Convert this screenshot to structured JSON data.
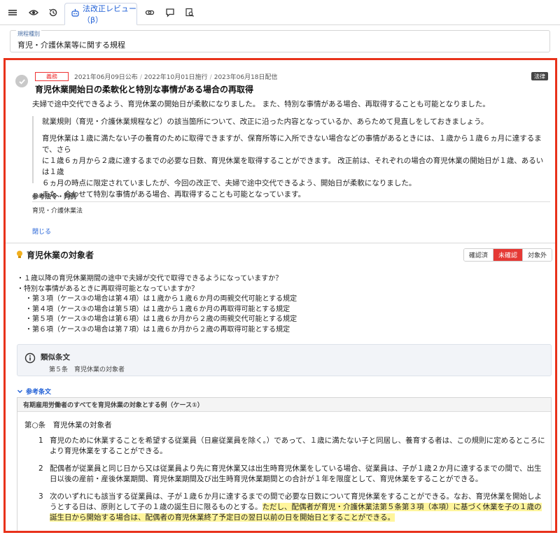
{
  "toolbar": {
    "tab_label": "法改正レビュー（β）",
    "icons": [
      "menu-icon",
      "eye-icon",
      "history-icon",
      "robot-icon",
      "link-icon",
      "comment-icon",
      "search-doc-icon"
    ]
  },
  "field": {
    "label": "規程種別",
    "value": "育児・介護休業等に関する規程"
  },
  "item1": {
    "badge": "義務",
    "dates": [
      "2021年06月09日公布",
      "2022年10月01日施行",
      "2023年06月18日配信"
    ],
    "tag": "法律",
    "title": "育児休業開始日の柔軟化と特別な事情がある場合の再取得",
    "summary": "夫婦で途中交代できるよう、育児休業の開始日が柔軟になりました。 また、特別な事情がある場合、再取得することも可能となりました。",
    "quote_p1": "就業規則（育児・介護休業規程など）の該当箇所について、改正に沿った内容となっているか、あらためて見直しをしておきましょう。",
    "quote_p2_lines": [
      "育児休業は１歳に満たない子の養育のために取得できますが、保育所等に入所できない場合などの事情があるときには、１歳から１歳６ヵ月に達するまで、さら",
      "に１歳６ヵ月から２歳に達するまでの必要な日数、育児休業を取得することができます。 改正前は、それぞれの場合の育児休業の開始日が１歳、あるいは１歳",
      "６ヵ月の時点に限定されていましたが、今回の改正で、夫婦で途中交代できるよう、開始日が柔軟になりました。",
      "また、合わせて特別な事情がある場合、再取得することも可能となっています。"
    ],
    "ref_heading": "参考法令・判例",
    "ref_item": "育児・介護休業法",
    "close_label": "閉じる"
  },
  "item2": {
    "title": "育児休業の対象者",
    "status_options": [
      "確認済",
      "未確認",
      "対象外"
    ],
    "status_selected": "未確認",
    "questions": [
      "・１歳以降の育児休業期間の途中で夫婦が交代で取得できるようになっていますか？",
      "・特別な事情があるときに再取得可能となっていますか？"
    ],
    "sub_items": [
      "・第３項（ケース③の場合は第４項）は１歳から１歳６か月の両親交代可能とする規定",
      "・第４項（ケース③の場合は第５項）は１歳から１歳６か月の再取得可能とする規定",
      "・第５項（ケース③の場合は第６項）は１歳６か月から２歳の両親交代可能とする規定",
      "・第６項（ケース③の場合は第７項）は１歳６か月から２歳の再取得可能とする規定"
    ],
    "similar_title": "類似条文",
    "similar_item": "第５条　育児休業の対象者",
    "ref_toggle": "参考条文",
    "refbox_heading": "有期雇用労働者のすべてを育児休業の対象とする例（ケース①）",
    "article_title": "第○条　育児休業の対象者",
    "clauses": [
      {
        "num": "1",
        "text": "育児のために休業することを希望する従業員（日雇従業員を除く。）であって、１歳に満たない子と同居し、養育する者は、この規則に定めるところにより育児休業をすることができる。"
      },
      {
        "num": "2",
        "text": "配偶者が従業員と同じ日から又は従業員より先に育児休業又は出生時育児休業をしている場合、従業員は、子が１歳２か月に達するまでの間で、出生日以後の産前・産後休業期間、育児休業期間及び出生時育児休業期間との合計が１年を限度として、育児休業をすることができる。"
      },
      {
        "num": "3",
        "text": "次のいずれにも該当する従業員は、子が１歳６か月に達するまでの間で必要な日数について育児休業をすることができる。なお、育児休業を開始しようとする日は、原則として子の１歳の誕生日に限るものとする。",
        "highlight": "ただし、配偶者が育児・介護休業法第５条第３項（本項）に基づく休業を子の１歳の誕生日から開始する場合は、配偶者の育児休業終了予定日の翌日以前の日を開始日とすることができる。"
      }
    ]
  },
  "colors": {
    "accent": "#1f5fd6",
    "alert": "#e8321b",
    "status_on": "#e53935",
    "highlight": "#fff59d"
  }
}
